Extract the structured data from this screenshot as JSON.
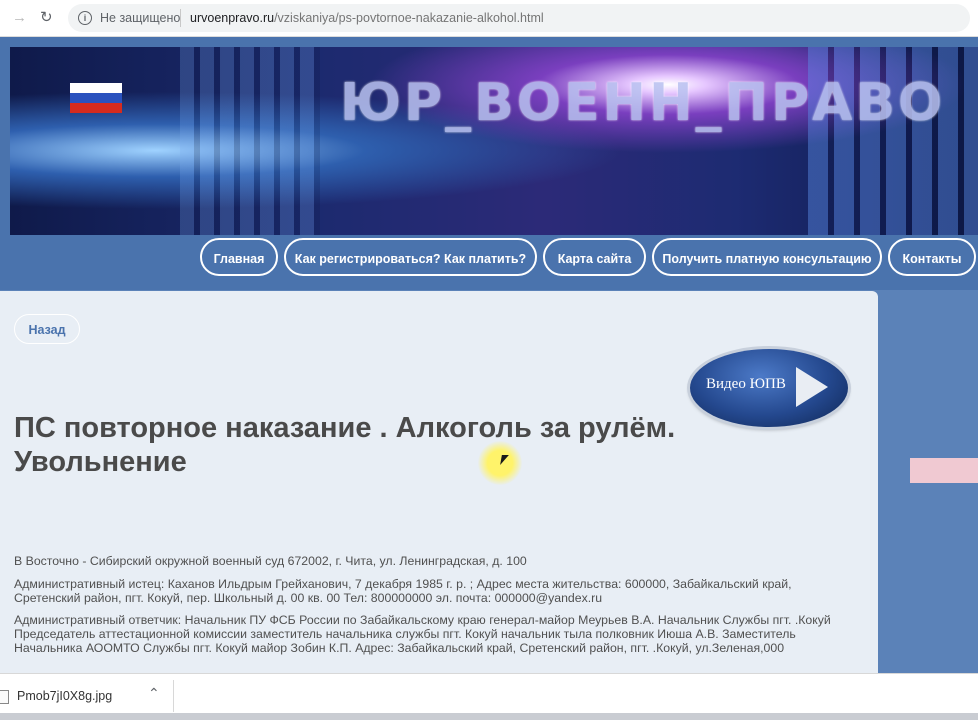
{
  "browser": {
    "security_text": "Не защищено",
    "url_domain": "urvoenpravo.ru",
    "url_path": "/vziskaniya/ps-povtornoe-nakazanie-alkohol.html"
  },
  "banner": {
    "title": "ЮР_ВОЕНН_ПРАВО"
  },
  "nav": {
    "items": [
      {
        "label": "Главная"
      },
      {
        "label": "Как регистрироваться? Как платить?"
      },
      {
        "label": "Карта сайта"
      },
      {
        "label": "Получить платную консультацию"
      },
      {
        "label": "Контакты"
      }
    ]
  },
  "content": {
    "back_label": "Назад",
    "video_label": "Видео ЮПВ",
    "title_line1": "ПС повторное наказание . Алкоголь за рулём.",
    "title_line2": "Увольнение",
    "paragraphs": [
      "В Восточно - Сибирский окружной военный суд 672002, г. Чита, ул. Ленинградская, д. 100",
      "Административный истец: Каханов Ильдрым Грейханович, 7 декабря 1985 г. р. ; Адрес места жительства: 600000, Забайкальский край, Сретенский район, пгт. Кокуй, пер. Школьный д. 00 кв. 00 Тел: 800000000 эл. почта: 000000@yandex.ru",
      "Административный ответчик: Начальник ПУ ФСБ России по Забайкальскому краю генерал-майор Меурьев В.А. Начальник Службы пгт. .Кокуй Председатель аттестационной комиссии заместитель начальника службы пгт. Кокуй начальник тыла полковник Июша А.В. Заместитель Начальника АООМТО Службы пгт. Кокуй майор Зобин К.П. Адрес: Забайкальский край, Сретенский район, пгт. .Кокуй, ул.Зеленая,000"
    ]
  },
  "download_bar": {
    "file_name": "Pmob7jI0X8g.jpg"
  },
  "colors": {
    "accent": "#4a73ad",
    "page_background": "#5b82b8",
    "content_background": "#e8eef5"
  }
}
